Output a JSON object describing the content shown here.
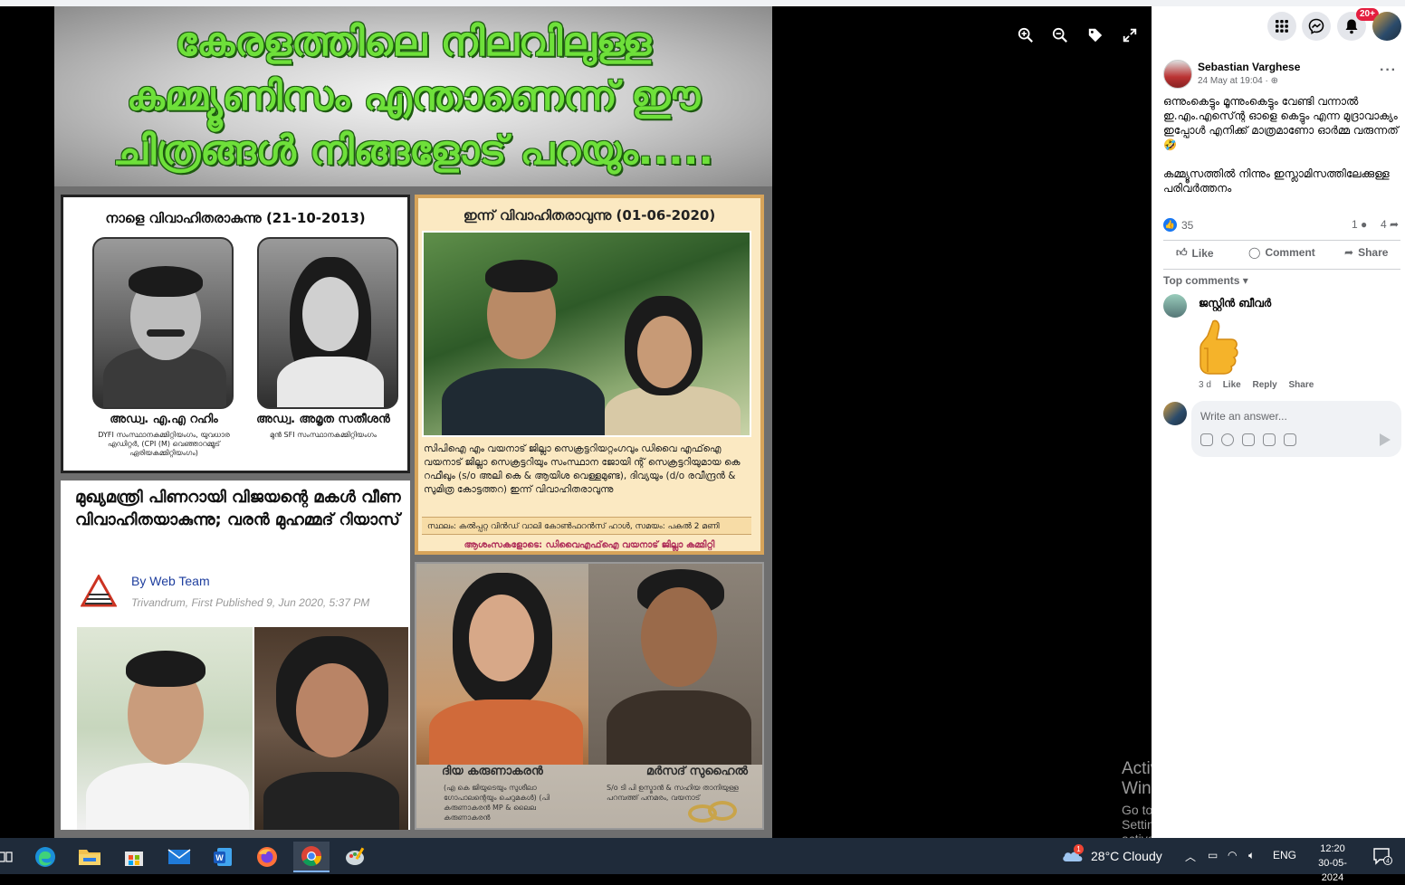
{
  "viewer": {
    "banner_lines": [
      "കേരളത്തിലെ നിലവിലുള്ള",
      "കമ്മ്യൂണിസം എന്താണെന്ന് ഈ",
      "ചിത്രങ്ങൾ നിങ്ങളോട് പറയും....."
    ],
    "panel1": {
      "heading": "നാളെ വിവാഹിതരാകുന്നു (21-10-2013)",
      "groom_name": "അഡ്വ. എ.എ റഹിം",
      "groom_sub": "DYFI സംസ്ഥാനകമ്മിറ്റിയംഗം, യുവധാര എഡിറ്റർ, (CPI (M) വെഞ്ഞാറമ്മൂട് ഏരിയകമ്മിറ്റിയംഗം)",
      "bride_name": "അഡ്വ. അമൃത സതീശൻ",
      "bride_sub": "മുൻ SFI സംസ്ഥാനകമ്മിറ്റിയംഗം"
    },
    "panel2": {
      "heading": "ഇന്ന് വിവാഹിതരാവുന്നു (01-06-2020)",
      "body": "സിപിഐ എം വയനാട് ജില്ലാ സെക്രട്ടറിയറ്റംഗവും ഡിവൈ എഫ്ഐ വയനാട് ജില്ലാ സെക്രട്ടറിയും സംസ്ഥാന ജോയി ന്റ് സെക്രട്ടറിയുമായ കെ റഫീഖും (s/o അലി കെ & ആയിശ വെള്ളമുണ്ട), ദിവ്യയും (d/o രവീന്ദ്രൻ & സുമിത്ര കോട്ടത്തറ) ഇന്ന് വിവാഹിതരാവുന്നു",
      "venue": "സ്ഥലം: കൽപ്പറ്റ വിൻഡ് വാലി കോൺഫറൻസ് ഹാൾ, സമയം: പകൽ 2 മണി",
      "greeting": "ആശംസകളോടെ: ഡിവൈഎഫ്ഐ വയനാട് ജില്ലാ കമ്മിറ്റി"
    },
    "panel3": {
      "heading": "മുഖ്യമന്ത്രി പിണറായി വിജയന്റെ മകൾ വീണ വിവാഹിതയാകുന്നു; വരൻ മുഹമ്മദ് റിയാസ്",
      "byline": "By Web Team",
      "meta": "Trivandrum, First Published 9, Jun 2020, 5:37 PM"
    },
    "panel4": {
      "bride_name": "ദിയ കരുണാകരൻ",
      "bride_sub": "(എ കെ ജിയുടെയും സുശീലാ ഗോപാലന്റെയും ചെറുമകൾ) (പി കരുണാകരൻ MP & ലൈല കരുണാകരൻ",
      "groom_name": "മർസദ് സുഹൈൽ",
      "groom_sub": "S/o ടി പി ഉസ്മാൻ & സഹിയ താനിയുള്ള പറമ്പത്ത് പനമരം, വയനാട്"
    },
    "tools": [
      "zoom-in-icon",
      "zoom-out-icon",
      "tag-icon",
      "fullscreen-icon"
    ],
    "watermark_title": "Activate Windows",
    "watermark_sub": "Go to Settings to activate Windows."
  },
  "sidebar": {
    "notification_badge": "20+",
    "author": "Sebastian Varghese",
    "post_meta": "24 May at 19:04 · ",
    "post_paragraphs": [
      "ഒന്നുംകെട്ടും മൂന്നുംകെട്ടും വേണ്ടി വന്നാൽ ഇ.എം.എസ്ന്റെ ഓളെ കെട്ടും എന്ന മുദ്രാവാക്യം ഇപ്പോൾ എനിക്ക് മാത്രമാണോ ഓർമ്മ വരുന്നത് 🤣",
      "കമ്മ്യൂസത്തിൽ നിന്നും ഇസ്ലാമിസത്തിലേക്കുള്ള പരിവർത്തനം"
    ],
    "like_count": "35",
    "comment_count": "1",
    "share_count": "4",
    "actions": {
      "like": "Like",
      "comment": "Comment",
      "share": "Share"
    },
    "top_comments_label": "Top comments",
    "comment": {
      "name": "ജസ്റ്റിൻ ബീവർ",
      "time": "3 d",
      "like": "Like",
      "reply": "Reply",
      "share": "Share"
    },
    "reply_placeholder": "Write an answer..."
  },
  "taskbar": {
    "weather": "28°C  Cloudy",
    "weather_badge": "1",
    "language": "ENG",
    "time": "12:20",
    "date": "30-05-2024",
    "notif_count": "4",
    "apps": [
      "edge-icon",
      "file-explorer-icon",
      "store-icon",
      "mail-icon",
      "word-icon",
      "firefox-icon",
      "chrome-icon",
      "paint-icon"
    ]
  }
}
